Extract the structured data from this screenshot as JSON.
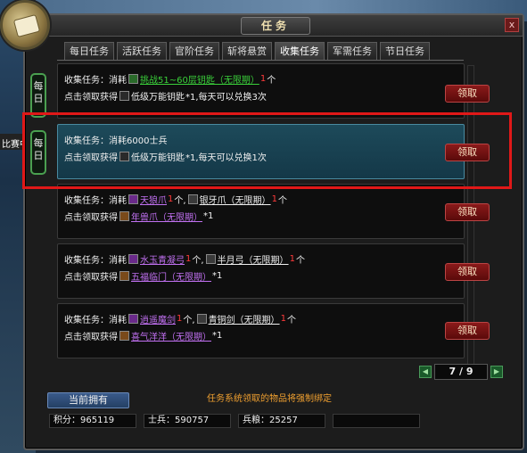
{
  "window": {
    "title": "任务",
    "close_label": "x"
  },
  "background": {
    "side_text": "比赛中"
  },
  "tabs": [
    {
      "label": "每日任务",
      "active": false
    },
    {
      "label": "活跃任务",
      "active": false
    },
    {
      "label": "官阶任务",
      "active": false
    },
    {
      "label": "斩将悬赏",
      "active": false
    },
    {
      "label": "收集任务",
      "active": true
    },
    {
      "label": "军需任务",
      "active": false
    },
    {
      "label": "节日任务",
      "active": false
    }
  ],
  "daily_badges": [
    {
      "label": "每日"
    },
    {
      "label": "每日"
    }
  ],
  "tasks": [
    {
      "consume_label": "收集任务：消耗",
      "consume_items": [
        {
          "name": "挑战51~60层钥匙（无限期）",
          "count": "1",
          "suffix": "个",
          "color": "green"
        }
      ],
      "reward_label": "点击领取获得",
      "reward_name": "低级万能钥匙",
      "reward_suffix": "*1,每天可以兑换3次",
      "reward_color": "white",
      "button": "领取"
    },
    {
      "consume_label": "收集任务：消耗6000士兵",
      "consume_items": [],
      "reward_label": "点击领取获得",
      "reward_name": "低级万能钥匙",
      "reward_suffix": "*1,每天可以兑换1次",
      "reward_color": "white",
      "button": "领取"
    },
    {
      "consume_label": "收集任务：消耗",
      "consume_items": [
        {
          "name": "天狼爪",
          "count": "1",
          "suffix": "个,",
          "color": "purple"
        },
        {
          "name": "银牙爪（无限期）",
          "count": "1",
          "suffix": "个",
          "color": "white"
        }
      ],
      "reward_label": "点击领取获得",
      "reward_name": "年兽爪（无限期）",
      "reward_suffix": "*1",
      "reward_color": "purple",
      "button": "领取"
    },
    {
      "consume_label": "收集任务：消耗",
      "consume_items": [
        {
          "name": "水玉青凝弓",
          "count": "1",
          "suffix": "个,",
          "color": "purple"
        },
        {
          "name": "半月弓（无限期）",
          "count": "1",
          "suffix": "个",
          "color": "white"
        }
      ],
      "reward_label": "点击领取获得",
      "reward_name": "五福临门（无限期）",
      "reward_suffix": "*1",
      "reward_color": "purple",
      "button": "领取"
    },
    {
      "consume_label": "收集任务：消耗",
      "consume_items": [
        {
          "name": "逍遥魔剑",
          "count": "1",
          "suffix": "个,",
          "color": "purple"
        },
        {
          "name": "青铜剑（无限期）",
          "count": "1",
          "suffix": "个",
          "color": "white"
        }
      ],
      "reward_label": "点击领取获得",
      "reward_name": "喜气洋洋（无限期）",
      "reward_suffix": "*1",
      "reward_color": "purple",
      "button": "领取"
    }
  ],
  "pager": {
    "current": "7",
    "separator": "/",
    "total": "9",
    "prev_icon": "arrow-left-icon",
    "next_icon": "arrow-right-icon"
  },
  "footer": {
    "owned_button": "当前拥有",
    "notice": "任务系统领取的物品将强制绑定",
    "stats": [
      {
        "label": "积分：",
        "value": "965119"
      },
      {
        "label": "士兵：",
        "value": "590757"
      },
      {
        "label": "兵粮：",
        "value": "25257"
      },
      {
        "label": "",
        "value": ""
      }
    ]
  },
  "colors": {
    "green": "#3ad03a",
    "purple": "#c070f0",
    "count_red": "#ff3a3a",
    "highlight": "#e01818",
    "notice": "#f0a030"
  }
}
